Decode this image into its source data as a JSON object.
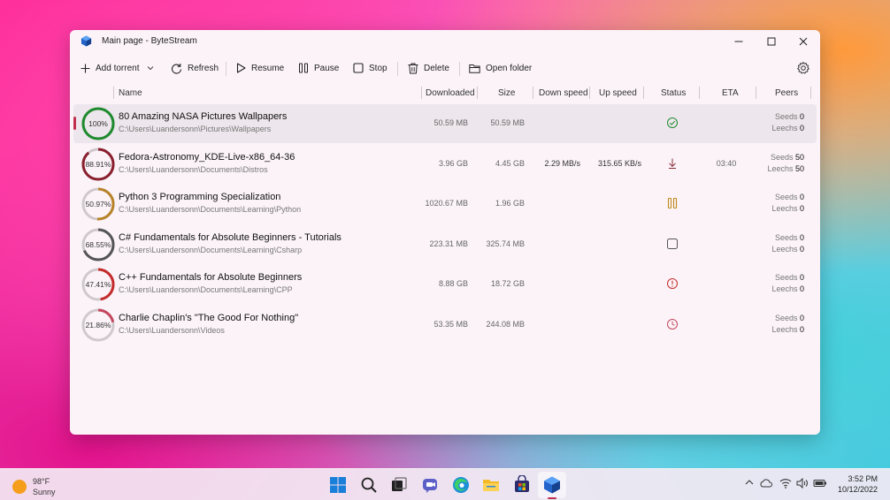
{
  "window": {
    "title": "Main page - ByteStream"
  },
  "toolbar": {
    "add_torrent": "Add torrent",
    "refresh": "Refresh",
    "resume": "Resume",
    "pause": "Pause",
    "stop": "Stop",
    "delete": "Delete",
    "open_folder": "Open folder"
  },
  "columns": {
    "name": "Name",
    "downloaded": "Downloaded",
    "size": "Size",
    "down_speed": "Down speed",
    "up_speed": "Up speed",
    "status": "Status",
    "eta": "ETA",
    "peers": "Peers"
  },
  "torrents": [
    {
      "progress": 1.0,
      "percent_label": "100%",
      "ring_color": "#1e8a2e",
      "name": "80 Amazing NASA Pictures Wallpapers",
      "path": "C:\\Users\\Luandersonn\\Pictures\\Wallpapers",
      "downloaded": "50.59 MB",
      "size": "50.59 MB",
      "down_speed": "",
      "up_speed": "",
      "status_icon": "check-circle-icon",
      "status_color": "#1e8a2e",
      "eta": "",
      "seeds_label": "Seeds",
      "seeds": "0",
      "leechs_label": "Leechs",
      "leechs": "0",
      "selected": true
    },
    {
      "progress": 0.8891,
      "percent_label": "88.91%",
      "ring_color": "#8a1f2e",
      "name": "Fedora-Astronomy_KDE-Live-x86_64-36",
      "path": "C:\\Users\\Luandersonn\\Documents\\Distros",
      "downloaded": "3.96 GB",
      "size": "4.45 GB",
      "down_speed": "2.29 MB/s",
      "up_speed": "315.65 KB/s",
      "status_icon": "download-arrow-icon",
      "status_color": "#8a2e3a",
      "eta": "03:40",
      "seeds_label": "Seeds",
      "seeds": "50",
      "leechs_label": "Leechs",
      "leechs": "50",
      "selected": false
    },
    {
      "progress": 0.5097,
      "percent_label": "50.97%",
      "ring_color": "#b8832a",
      "name": "Python 3 Programming Specialization",
      "path": "C:\\Users\\Luandersonn\\Documents\\Learning\\Python",
      "downloaded": "1020.67 MB",
      "size": "1.96 GB",
      "down_speed": "",
      "up_speed": "",
      "status_icon": "pause-icon",
      "status_color": "#c08a1c",
      "eta": "",
      "seeds_label": "Seeds",
      "seeds": "0",
      "leechs_label": "Leechs",
      "leechs": "0",
      "selected": false
    },
    {
      "progress": 0.6855,
      "percent_label": "68.55%",
      "ring_color": "#555555",
      "name": "C# Fundamentals for Absolute Beginners - Tutorials",
      "path": "C:\\Users\\Luandersonn\\Documents\\Learning\\Csharp",
      "downloaded": "223.31 MB",
      "size": "325.74 MB",
      "down_speed": "",
      "up_speed": "",
      "status_icon": "stop-square-icon",
      "status_color": "#555555",
      "eta": "",
      "seeds_label": "Seeds",
      "seeds": "0",
      "leechs_label": "Leechs",
      "leechs": "0",
      "selected": false
    },
    {
      "progress": 0.4741,
      "percent_label": "47.41%",
      "ring_color": "#c42b2b",
      "name": "C++ Fundamentals for Absolute Beginners",
      "path": "C:\\Users\\Luandersonn\\Documents\\Learning\\CPP",
      "downloaded": "8.88 GB",
      "size": "18.72 GB",
      "down_speed": "",
      "up_speed": "",
      "status_icon": "error-circle-icon",
      "status_color": "#c42b2b",
      "eta": "",
      "seeds_label": "Seeds",
      "seeds": "0",
      "leechs_label": "Leechs",
      "leechs": "0",
      "selected": false
    },
    {
      "progress": 0.2186,
      "percent_label": "21.86%",
      "ring_color": "#c4465e",
      "name": "Charlie Chaplin's \"The Good For Nothing\"",
      "path": "C:\\Users\\Luandersonn\\Videos",
      "downloaded": "53.35 MB",
      "size": "244.08 MB",
      "down_speed": "",
      "up_speed": "",
      "status_icon": "clock-icon",
      "status_color": "#c4465e",
      "eta": "",
      "seeds_label": "Seeds",
      "seeds": "0",
      "leechs_label": "Leechs",
      "leechs": "0",
      "selected": false
    }
  ],
  "taskbar": {
    "weather_temp": "98°F",
    "weather_desc": "Sunny",
    "time": "3:52 PM",
    "date": "10/12/2022"
  },
  "colors": {
    "accent": "#c0304f",
    "window_bg": "#fbf3f8"
  }
}
